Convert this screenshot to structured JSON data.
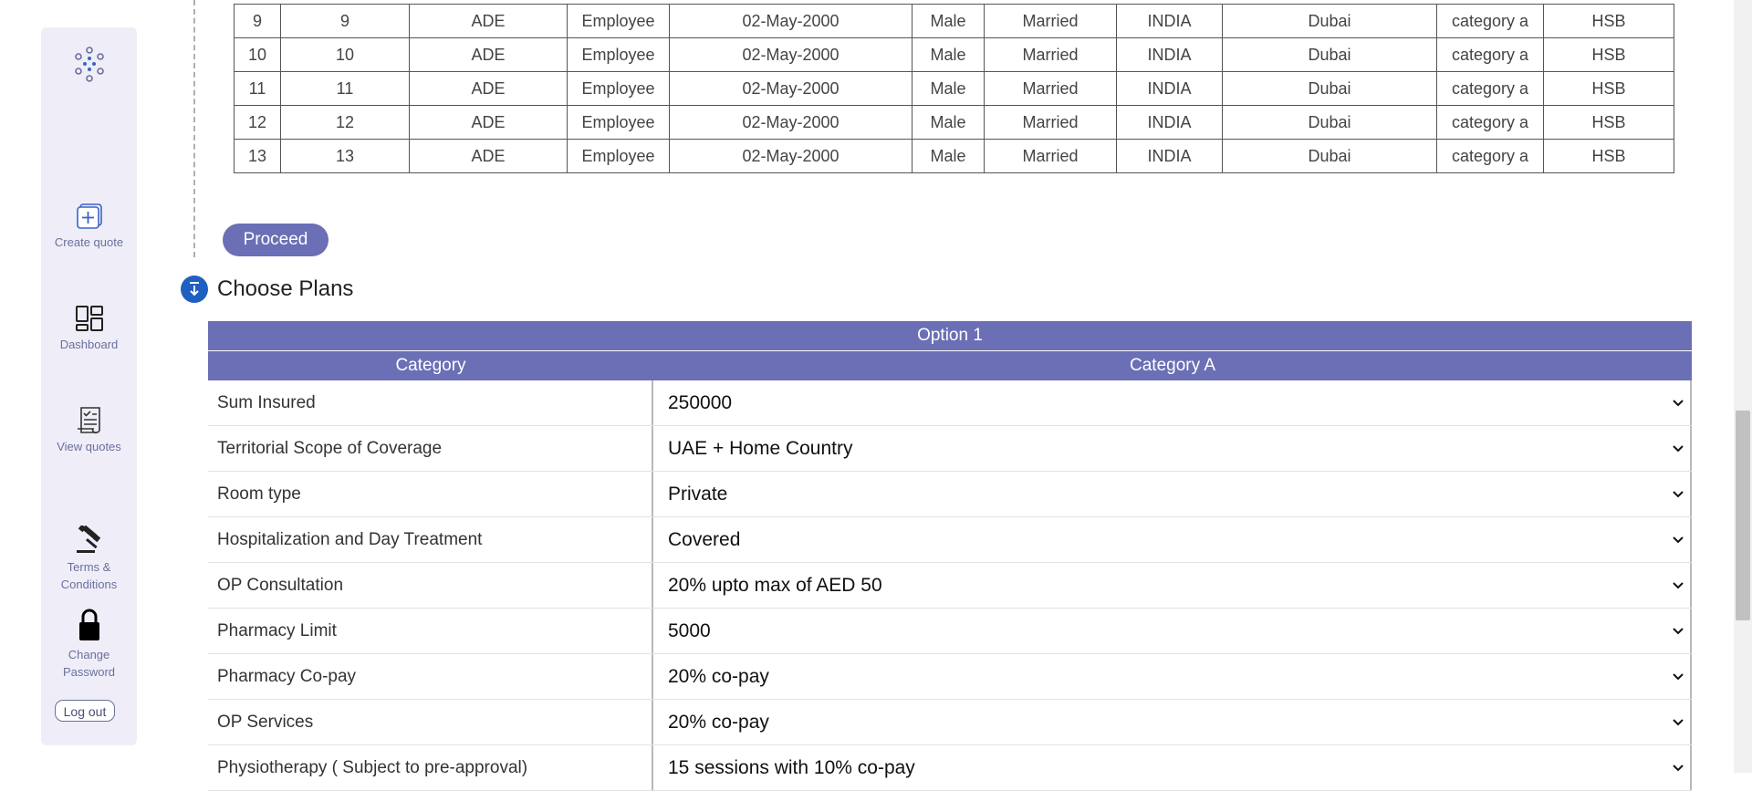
{
  "sidebar": {
    "items": [
      {
        "label": "Create quote",
        "icon": "plus-square-icon"
      },
      {
        "label": "Dashboard",
        "icon": "dashboard-grid-icon"
      },
      {
        "label": "View quotes",
        "icon": "document-check-icon"
      },
      {
        "label": "Terms & Conditions",
        "icon": "gavel-icon"
      },
      {
        "label": "Change Password",
        "icon": "lock-icon"
      }
    ],
    "logout_label": "Log out",
    "accent": "#6a6f9d"
  },
  "members": {
    "rows": [
      [
        "9",
        "9",
        "ADE",
        "Employee",
        "02-May-2000",
        "Male",
        "Married",
        "INDIA",
        "Dubai",
        "category a",
        "HSB"
      ],
      [
        "10",
        "10",
        "ADE",
        "Employee",
        "02-May-2000",
        "Male",
        "Married",
        "INDIA",
        "Dubai",
        "category a",
        "HSB"
      ],
      [
        "11",
        "11",
        "ADE",
        "Employee",
        "02-May-2000",
        "Male",
        "Married",
        "INDIA",
        "Dubai",
        "category a",
        "HSB"
      ],
      [
        "12",
        "12",
        "ADE",
        "Employee",
        "02-May-2000",
        "Male",
        "Married",
        "INDIA",
        "Dubai",
        "category a",
        "HSB"
      ],
      [
        "13",
        "13",
        "ADE",
        "Employee",
        "02-May-2000",
        "Male",
        "Married",
        "INDIA",
        "Dubai",
        "category a",
        "HSB"
      ]
    ]
  },
  "proceed_label": "Proceed",
  "section": {
    "title": "Choose Plans",
    "icon": "arrow-down-to-line-icon"
  },
  "plans": {
    "option_header": "Option 1",
    "category_header": "Category",
    "category_value": "Category A",
    "header_color": "#6b6fb5",
    "rows": [
      {
        "label": "Sum Insured",
        "value": "250000"
      },
      {
        "label": "Territorial Scope of Coverage",
        "value": "UAE + Home Country"
      },
      {
        "label": "Room type",
        "value": "Private"
      },
      {
        "label": "Hospitalization and Day Treatment",
        "value": "Covered"
      },
      {
        "label": "OP Consultation",
        "value": "20% upto max of AED 50"
      },
      {
        "label": "Pharmacy Limit",
        "value": "5000"
      },
      {
        "label": "Pharmacy Co-pay",
        "value": "20% co-pay"
      },
      {
        "label": "OP Services",
        "value": "20% co-pay"
      },
      {
        "label": "Physiotherapy ( Subject to pre-approval)",
        "value": "15 sessions with 10% co-pay"
      }
    ]
  }
}
